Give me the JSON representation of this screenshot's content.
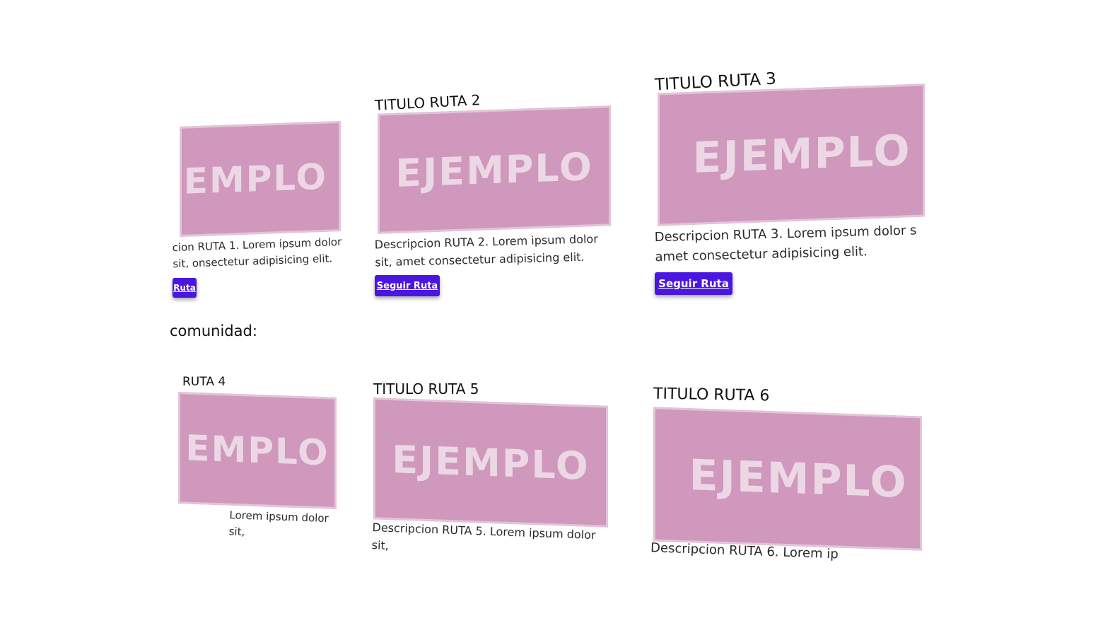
{
  "section": {
    "heading": "comunidad:"
  },
  "cards": [
    {
      "title": "",
      "image_text": "EJEMPLO",
      "description": "cion RUTA 1. Lorem ipsum dolor sit, onsectetur adipisicing elit.",
      "button": "Ruta"
    },
    {
      "title": "TITULO RUTA 2",
      "image_text": "EJEMPLO",
      "description": "Descripcion RUTA 2. Lorem ipsum dolor sit, amet consectetur adipisicing elit.",
      "button": "Seguir Ruta"
    },
    {
      "title": "TITULO RUTA 3",
      "image_text": "EJEMPLO",
      "description": "Descripcion RUTA 3. Lorem ipsum dolor s amet consectetur adipisicing elit.",
      "button": "Seguir Ruta"
    },
    {
      "title": "RUTA 4",
      "image_text": "EMPLO",
      "description": "Lorem ipsum dolor sit,"
    },
    {
      "title": "TITULO RUTA 5",
      "image_text": "EJEMPLO",
      "description": "Descripcion RUTA 5. Lorem ipsum dolor sit,"
    },
    {
      "title": "TITULO RUTA 6",
      "image_text": "EJEMPLO",
      "description": "Descripcion RUTA 6. Lorem ip"
    }
  ],
  "colors": {
    "thumbnail": "#cf98bc",
    "thumbnail_text": "#ecd7e5",
    "button": "#4a16e0"
  }
}
